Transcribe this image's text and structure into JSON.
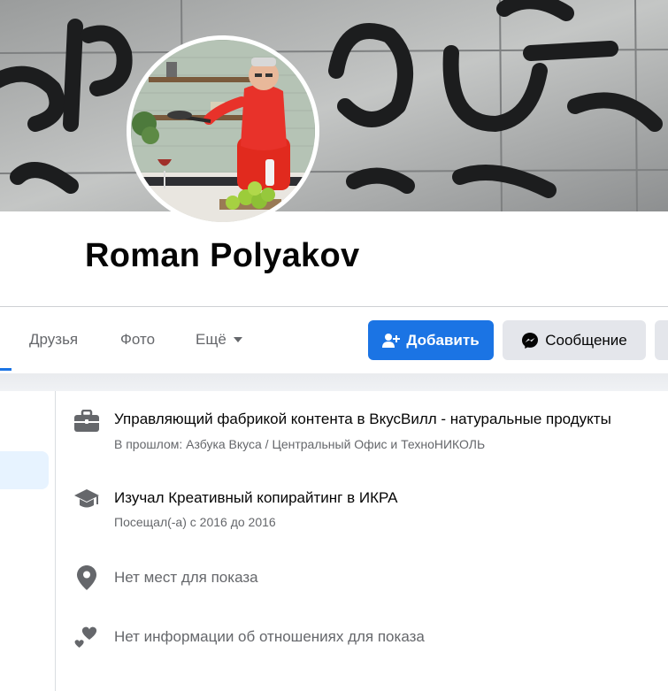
{
  "profile": {
    "name": "Roman Polyakov"
  },
  "tabs": [
    {
      "label": "Друзья"
    },
    {
      "label": "Фото"
    },
    {
      "label": "Ещё"
    }
  ],
  "actions": {
    "add_label": "Добавить",
    "message_label": "Сообщение"
  },
  "intro": {
    "work": {
      "title": "Управляющий фабрикой контента в ВкусВилл - натуральные продукты",
      "subtitle": "В прошлом: Азбука Вкуса / Центральный Офис и ТехноНИКОЛЬ"
    },
    "education": {
      "title": "Изучал Креативный копирайтинг в ИКРА",
      "subtitle": "Посещал(-а) с 2016 до 2016"
    },
    "places": {
      "title": "Нет мест для показа"
    },
    "relationship": {
      "title": "Нет информации об отношениях для показа"
    }
  },
  "icons": {
    "work": "briefcase-icon",
    "education": "graduation-cap-icon",
    "places": "location-pin-icon",
    "relationship": "hearts-icon",
    "add": "add-friend-icon",
    "message": "messenger-icon",
    "more": "caret-down-icon"
  },
  "colors": {
    "accent": "#1b74e4",
    "secondary_button": "#e4e6eb",
    "secondary_text": "#65676b",
    "highlight": "#e7f3ff"
  }
}
